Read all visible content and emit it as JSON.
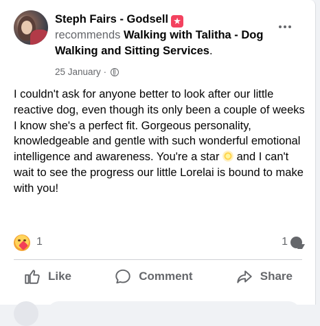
{
  "post": {
    "author": "Steph Fairs - Godsell",
    "author_badge_icon": "star-badge-icon",
    "verb": "recommends",
    "page_name": "Walking with Talitha - Dog Walking and Sitting Services",
    "punct": ".",
    "date": "25 January",
    "separator": "·",
    "privacy_icon": "globe-icon",
    "body_before_emoji": "I couldn't ask for anyone better to look after our little reactive dog, even though its only been a couple of weeks I know she's a perfect fit. Gorgeous personality, knowledgeable and gentle with such wonderful emotional intelligence and awareness. You're a star",
    "body_emoji": "sun-emoji",
    "body_after_emoji": " and I can't wait to see the progress our little Lorelai is bound to make with you!"
  },
  "reactions": {
    "emoji": "hugging-face-emoji",
    "count": "1",
    "comments": "1"
  },
  "actions": {
    "like": "Like",
    "comment": "Comment",
    "share": "Share"
  },
  "colors": {
    "text": "#050505",
    "secondary": "#65676b",
    "badge": "#f3425f",
    "background": "#f0f2f5"
  }
}
